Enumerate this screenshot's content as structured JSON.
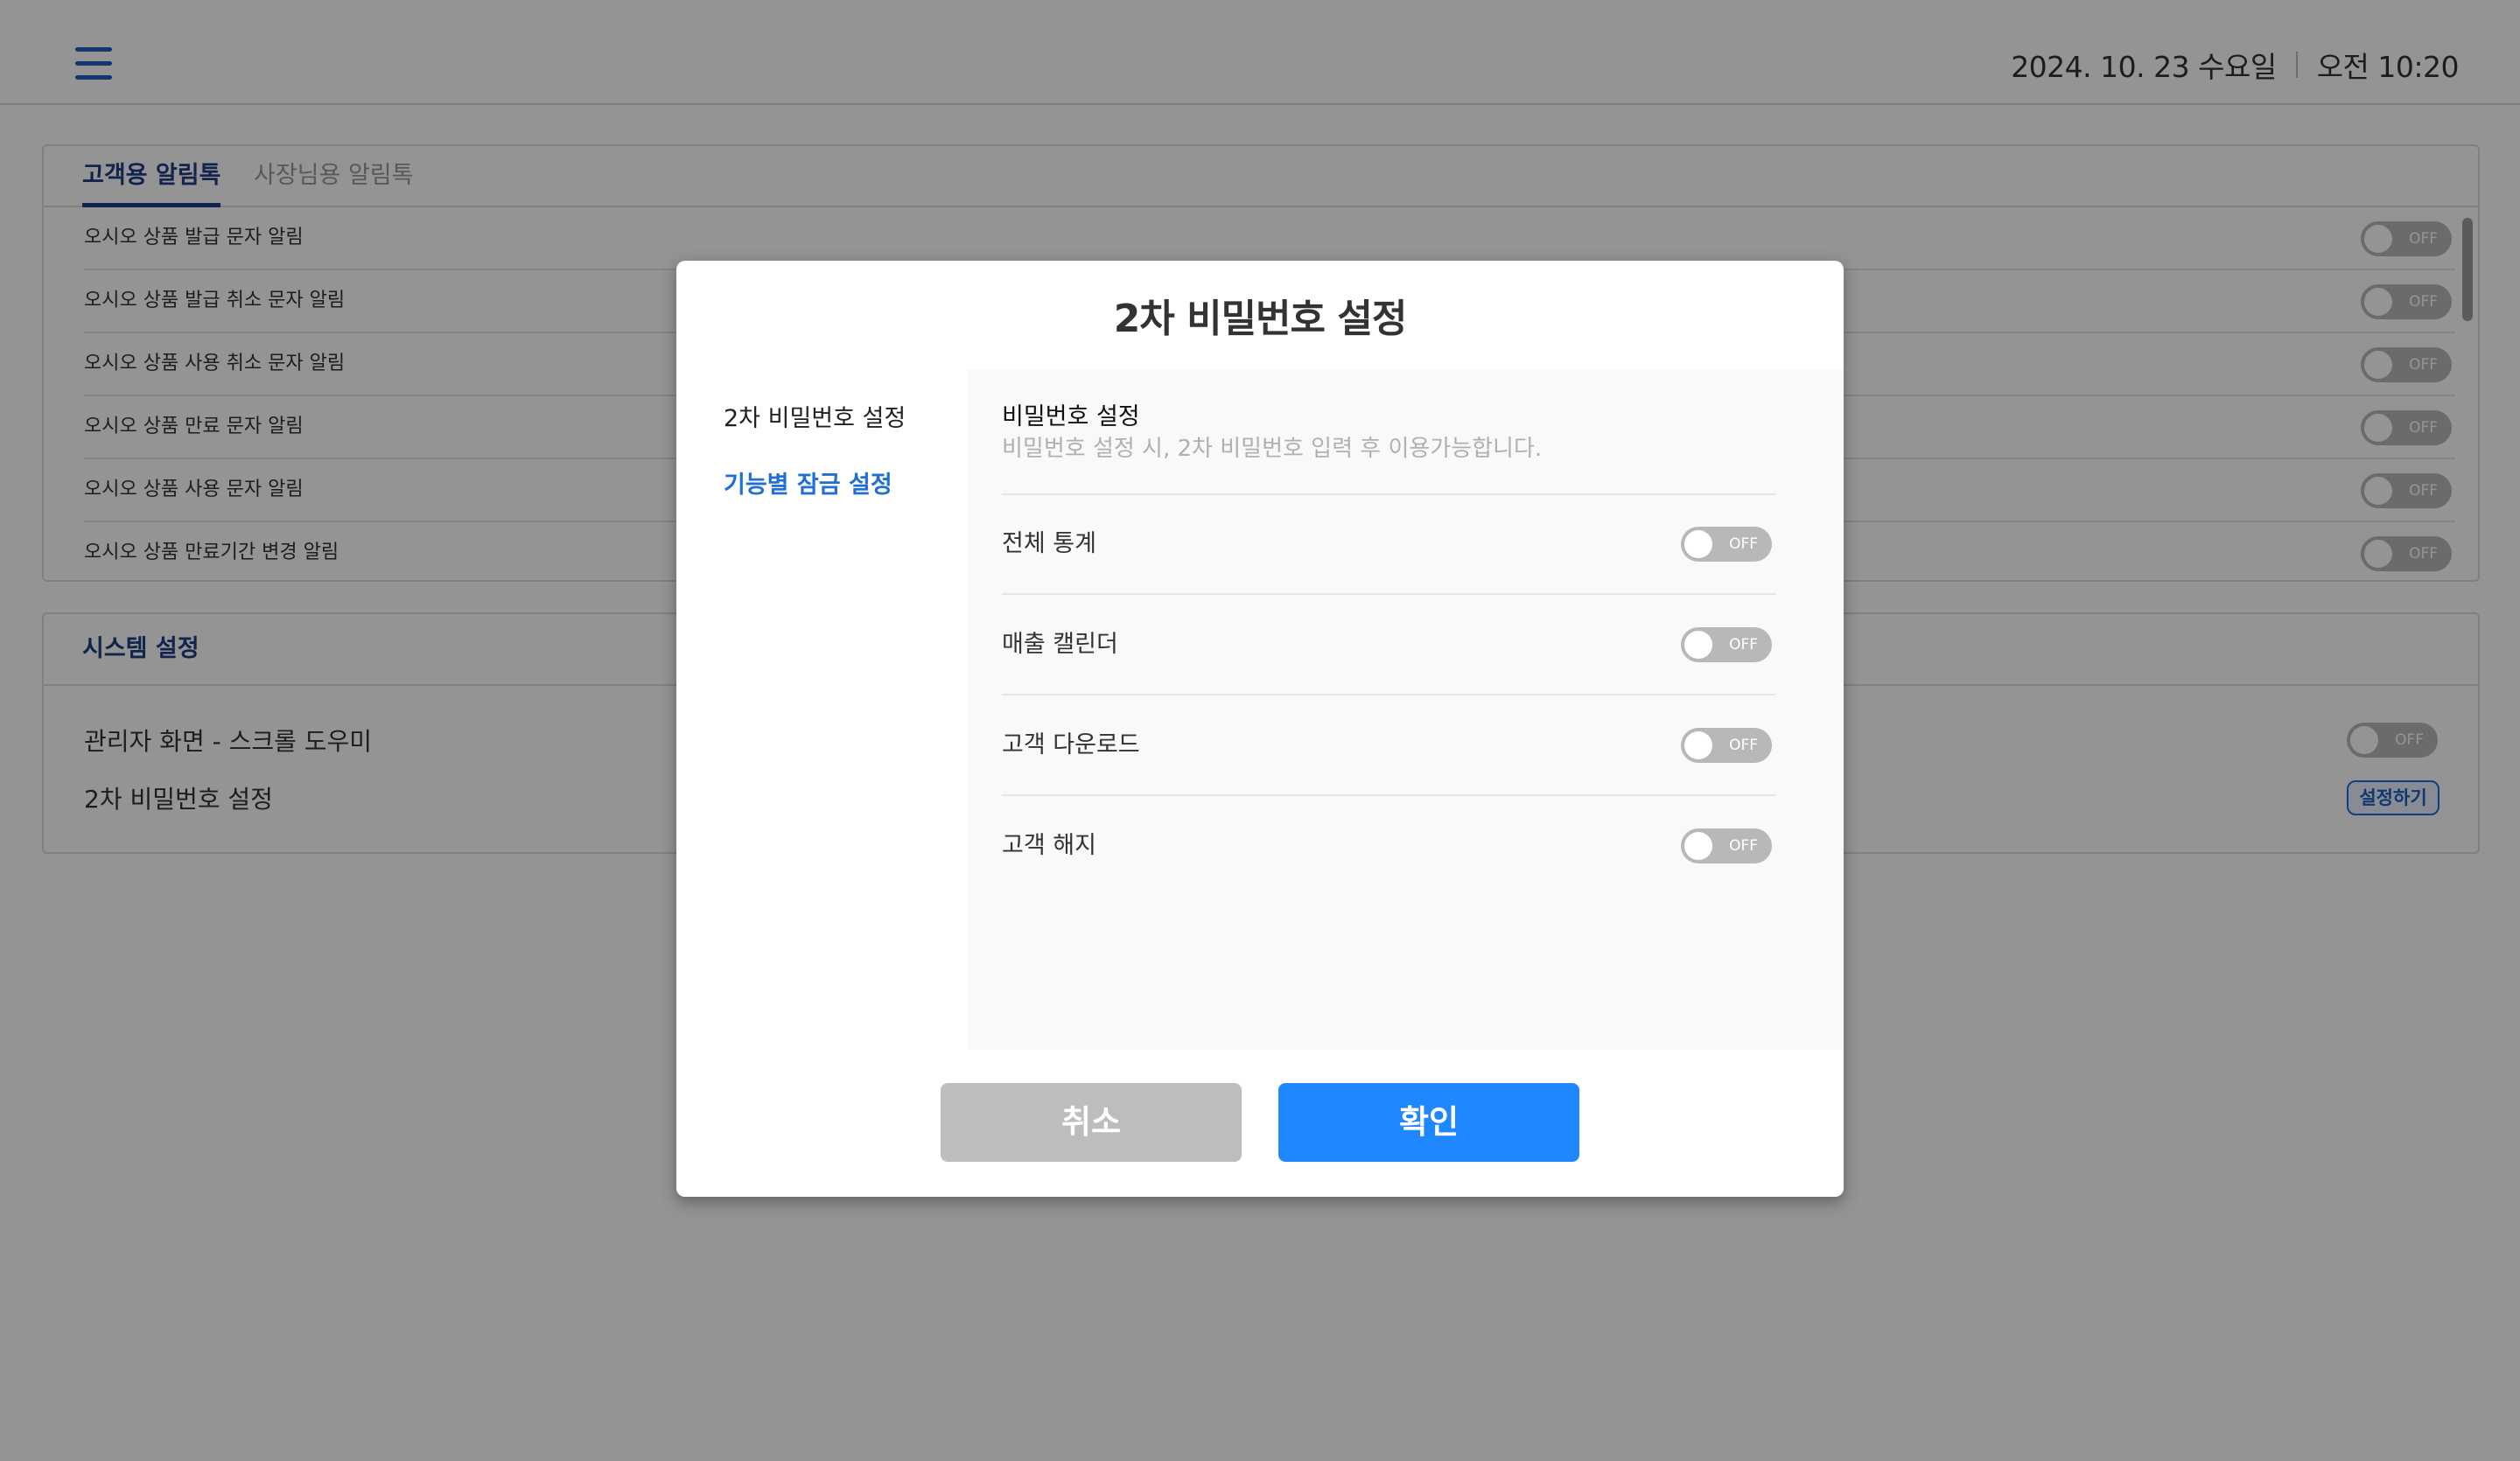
{
  "header": {
    "date": "2024. 10. 23 수요일",
    "time": "오전 10:20"
  },
  "tabs": [
    {
      "label": "고객용 알림톡",
      "active": true
    },
    {
      "label": "사장님용 알림톡",
      "active": false
    }
  ],
  "notification_rows": [
    {
      "label": "오시오 상품 발급 문자 알림",
      "toggle": "OFF"
    },
    {
      "label": "오시오 상품 발급 취소 문자 알림",
      "toggle": "OFF"
    },
    {
      "label": "오시오 상품 사용 취소 문자 알림",
      "toggle": "OFF"
    },
    {
      "label": "오시오 상품 만료 문자 알림",
      "toggle": "OFF"
    },
    {
      "label": "오시오 상품 사용 문자 알림",
      "toggle": "OFF"
    },
    {
      "label": "오시오 상품 만료기간 변경 알림",
      "toggle": "OFF"
    }
  ],
  "system": {
    "title": "시스템 설정",
    "rows": [
      {
        "label": "관리자 화면 - 스크롤 도우미",
        "toggle": "OFF"
      },
      {
        "label": "2차 비밀번호 설정",
        "button": "설정하기"
      }
    ]
  },
  "modal": {
    "title": "2차 비밀번호 설정",
    "nav": [
      {
        "label": "2차 비밀번호 설정",
        "active": false
      },
      {
        "label": "기능별 잠금 설정",
        "active": true
      }
    ],
    "section_title": "비밀번호 설정",
    "section_desc": "비밀번호 설정 시, 2차 비밀번호 입력 후 이용가능합니다.",
    "rows": [
      {
        "label": "전체 통계",
        "toggle": "OFF"
      },
      {
        "label": "매출 캘린더",
        "toggle": "OFF"
      },
      {
        "label": "고객 다운로드",
        "toggle": "OFF"
      },
      {
        "label": "고객 해지",
        "toggle": "OFF"
      }
    ],
    "cancel_label": "취소",
    "confirm_label": "확인"
  },
  "colors": {
    "accent": "#1f87ff",
    "brand_navy": "#1f3f85",
    "cancel_gray": "#bdbdbd",
    "toggle_off": "#b8b8b8"
  }
}
